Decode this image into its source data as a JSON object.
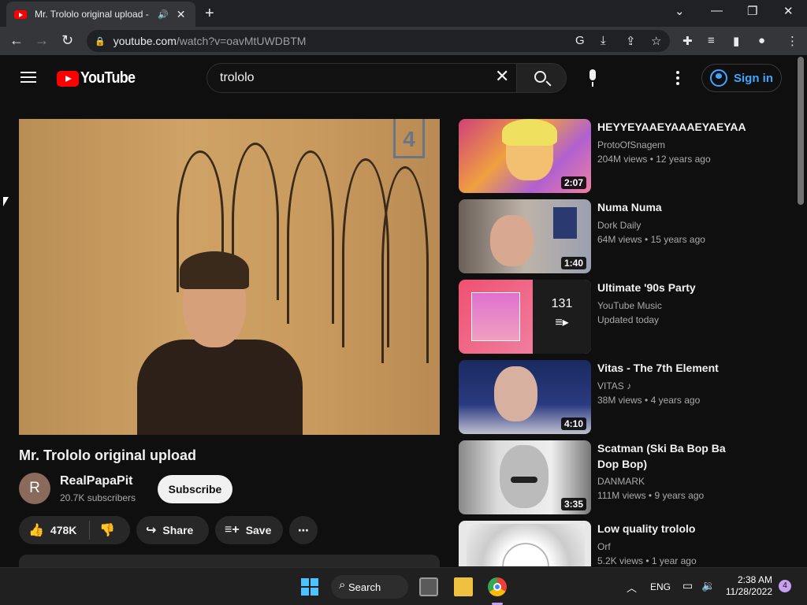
{
  "browser": {
    "tab_title": "Mr. Trololo original upload -",
    "url_host": "youtube.com",
    "url_path": "/watch?v=oavMtUWDBTM"
  },
  "masthead": {
    "logo_text": "YouTube",
    "search_value": "trololo",
    "signin_label": "Sign in"
  },
  "video": {
    "title": "Mr. Trololo original upload",
    "channel_initial": "R",
    "channel_name": "RealPapaPit",
    "subscribers": "20.7K subscribers",
    "subscribe_label": "Subscribe",
    "likes": "478K",
    "share_label": "Share",
    "save_label": "Save",
    "player_channel_mark": "4"
  },
  "sidebar": {
    "items": [
      {
        "title": "HEYYEYAAEYAAAEYAEYAA",
        "channel": "ProtoOfSnagem",
        "views": "204M views",
        "age": "12 years ago",
        "duration": "2:07"
      },
      {
        "title": "Numa Numa",
        "channel": "Dork Daily",
        "views": "64M views",
        "age": "15 years ago",
        "duration": "1:40"
      },
      {
        "title": "Ultimate '90s Party",
        "channel": "YouTube Music",
        "meta": "Updated today",
        "count": "131"
      },
      {
        "title": "Vitas - The 7th Element",
        "channel": "VITAS",
        "views": "38M views",
        "age": "4 years ago",
        "duration": "4:10"
      },
      {
        "title": "Scatman (Ski Ba Bop Ba Dop Bop)",
        "channel": "DANMARK",
        "views": "111M views",
        "age": "9 years ago",
        "duration": "3:35"
      },
      {
        "title": "Low quality trololo",
        "channel": "Orf",
        "views": "5.2K views",
        "age": "1 year ago"
      }
    ]
  },
  "taskbar": {
    "search_label": "Search",
    "language": "ENG",
    "time": "2:38 AM",
    "date": "11/28/2022",
    "notification_count": "4"
  },
  "colors": {
    "accent_red": "#ff0000",
    "link_blue": "#3ea6ff",
    "background": "#0f0f0f"
  }
}
